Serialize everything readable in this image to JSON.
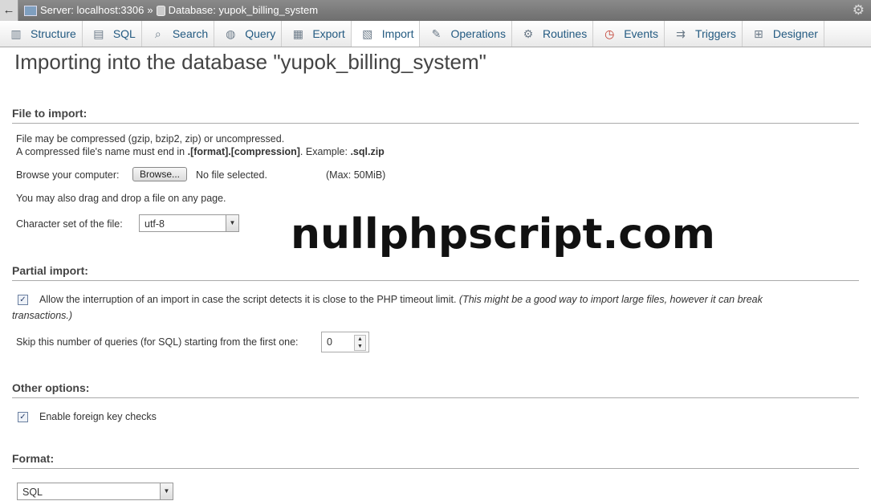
{
  "serverbar": {
    "back_glyph": "←",
    "server": "Server: localhost:3306",
    "sep": "»",
    "database": "Database: yupok_billing_system"
  },
  "tabs": [
    {
      "label": "Structure",
      "icon": "structure-icon"
    },
    {
      "label": "SQL",
      "icon": "sql-icon"
    },
    {
      "label": "Search",
      "icon": "search-icon"
    },
    {
      "label": "Query",
      "icon": "query-icon"
    },
    {
      "label": "Export",
      "icon": "export-icon"
    },
    {
      "label": "Import",
      "icon": "import-icon"
    },
    {
      "label": "Operations",
      "icon": "operations-icon"
    },
    {
      "label": "Routines",
      "icon": "routines-icon"
    },
    {
      "label": "Events",
      "icon": "events-icon"
    },
    {
      "label": "Triggers",
      "icon": "triggers-icon"
    },
    {
      "label": "Designer",
      "icon": "designer-icon"
    }
  ],
  "page_title": "Importing into the database \"yupok_billing_system\"",
  "file_to_import": {
    "title": "File to import:",
    "line1": "File may be compressed (gzip, bzip2, zip) or uncompressed.",
    "line2_a": "A compressed file's name must end in ",
    "line2_b": ".[format].[compression]",
    "line2_c": ". Example: ",
    "line2_d": ".sql.zip",
    "browse_label": "Browse your computer:",
    "browse_button": "Browse...",
    "no_file": "No file selected.",
    "max": "(Max: 50MiB)",
    "drag_drop": "You may also drag and drop a file on any page.",
    "charset_label": "Character set of the file:",
    "charset_value": "utf-8"
  },
  "partial_import": {
    "title": "Partial import:",
    "allow_text": "Allow the interruption of an import in case the script detects it is close to the PHP timeout limit. ",
    "allow_note_a": "(This might be a good way to import large files, however it can break",
    "allow_note_b": "transactions.)",
    "skip_label": "Skip this number of queries (for SQL) starting from the first one:",
    "skip_value": "0"
  },
  "other_options": {
    "title": "Other options:",
    "fk_label": "Enable foreign key checks"
  },
  "format": {
    "title": "Format:",
    "value": "SQL"
  },
  "watermark": "nullphpscript.com"
}
